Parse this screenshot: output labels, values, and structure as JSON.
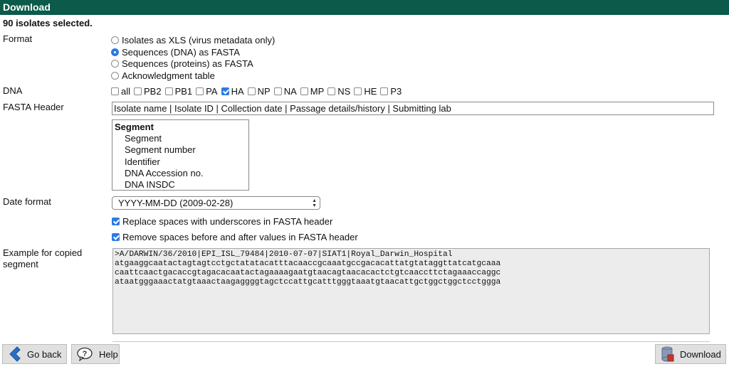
{
  "window": {
    "title": "Download"
  },
  "selection": {
    "summary": "90 isolates selected."
  },
  "format": {
    "label": "Format",
    "options": [
      {
        "label": "Isolates as XLS (virus metadata only)",
        "checked": false
      },
      {
        "label": "Sequences (DNA) as FASTA",
        "checked": true
      },
      {
        "label": "Sequences (proteins) as FASTA",
        "checked": false
      },
      {
        "label": "Acknowledgment table",
        "checked": false
      }
    ]
  },
  "dna": {
    "label": "DNA",
    "segments": [
      {
        "label": "all",
        "checked": false
      },
      {
        "label": "PB2",
        "checked": false
      },
      {
        "label": "PB1",
        "checked": false
      },
      {
        "label": "PA",
        "checked": false
      },
      {
        "label": "HA",
        "checked": true
      },
      {
        "label": "NP",
        "checked": false
      },
      {
        "label": "NA",
        "checked": false
      },
      {
        "label": "MP",
        "checked": false
      },
      {
        "label": "NS",
        "checked": false
      },
      {
        "label": "HE",
        "checked": false
      },
      {
        "label": "P3",
        "checked": false
      }
    ]
  },
  "fasta_header": {
    "label": "FASTA Header",
    "value": "Isolate name | Isolate ID | Collection date | Passage details/history | Submitting lab",
    "fields_group": "Segment",
    "fields": [
      "Segment",
      "Segment number",
      "Identifier",
      "DNA Accession no.",
      "DNA INSDC"
    ]
  },
  "date_format": {
    "label": "Date format",
    "selected": "YYYY-MM-DD (2009-02-28)"
  },
  "options": {
    "replace_spaces": {
      "label": "Replace spaces with underscores in FASTA header",
      "checked": true
    },
    "remove_spaces": {
      "label": "Remove spaces before and after values in FASTA header",
      "checked": true
    }
  },
  "example": {
    "label_line1": "Example for copied",
    "label_line2": "segment",
    "lines": [
      ">A/DARWIN/36/2010|EPI_ISL_79484|2010-07-07|SIAT1|Royal_Darwin_Hospital",
      "atgaaggcaatactagtagtcctgctatatacatttacaaccgcaaatgccgacacattatgtataggttatcatgcaaa",
      "caattcaactgacaccgtagacacaatactagaaaagaatgtaacagtaacacactctgtcaaccttctagaaaccaggc",
      "ataatgggaaactatgtaaactaagaggggtagctccattgcatttgggtaaatgtaacattgctggctggctcctggga"
    ]
  },
  "buttons": {
    "back": "Go back",
    "help": "Help",
    "download": "Download"
  },
  "icons": {
    "back": "arrow-left-icon",
    "help": "question-bubble-icon",
    "download": "database-download-icon"
  },
  "colors": {
    "titlebar": "#0b5a4a",
    "accent": "#2a7be4"
  }
}
